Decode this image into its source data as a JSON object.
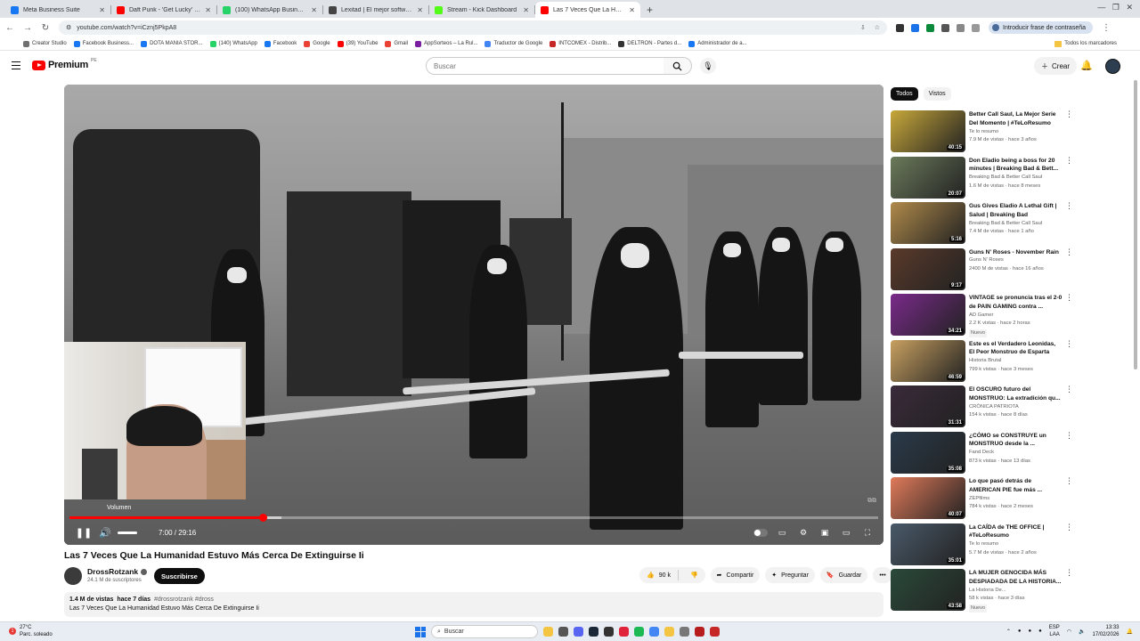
{
  "browser": {
    "tabs": [
      {
        "title": "Meta Business Suite",
        "color": "#1877f2",
        "active": false
      },
      {
        "title": "Daft Punk - 'Get Lucky' (10 min...",
        "color": "#ff0000",
        "active": false
      },
      {
        "title": "(100) WhatsApp Business",
        "color": "#25d366",
        "active": false
      },
      {
        "title": "Lexitad | El mejor software para...",
        "color": "#444444",
        "active": false
      },
      {
        "title": "Stream - Kick Dashboard",
        "color": "#53fc18",
        "active": false
      },
      {
        "title": "Las 7 Veces Que La Human...",
        "color": "#ff0000",
        "active": true
      }
    ],
    "url": "youtube.com/watch?v=iCznj5PkpA8",
    "profile_label": "Introducir frase de contraseña",
    "bookmarks": [
      {
        "label": "Creator Studio",
        "color": "#6f6f6f"
      },
      {
        "label": "Facebook Business...",
        "color": "#1877f2"
      },
      {
        "label": "DOTA MANIA STOR...",
        "color": "#1877f2"
      },
      {
        "label": "(140) WhatsApp",
        "color": "#25d366"
      },
      {
        "label": "Facebook",
        "color": "#1877f2"
      },
      {
        "label": "Google",
        "color": "#ea4335"
      },
      {
        "label": "(39) YouTube",
        "color": "#ff0000"
      },
      {
        "label": "Gmail",
        "color": "#ea4335"
      },
      {
        "label": "AppSorteos – La Rul...",
        "color": "#7b1fa2"
      },
      {
        "label": "Traductor de Google",
        "color": "#4285f4"
      },
      {
        "label": "INTCOMEX - Distrib...",
        "color": "#c62828"
      },
      {
        "label": "DELTRON - Partes d...",
        "color": "#333333"
      },
      {
        "label": "Administrador de a...",
        "color": "#1877f2"
      }
    ],
    "all_bookmarks": "Todos los marcadores"
  },
  "youtube": {
    "logo_text": "Premium",
    "logo_country": "PE",
    "search_placeholder": "Buscar",
    "create_label": "Crear",
    "player": {
      "tooltip": "Volumen",
      "current_time": "7:00",
      "duration": "29:16",
      "time_display": "7:00 / 29:16",
      "progress_fraction": 0.239,
      "buffered_fraction": 0.262
    },
    "video": {
      "title": "Las 7 Veces Que La Humanidad Estuvo Más Cerca De Extinguirse Ii",
      "channel": "DrossRotzank",
      "subscribers": "24.1 M de suscriptores",
      "subscribe_label": "Suscribirse",
      "likes": "90 k",
      "share_label": "Compartir",
      "ask_label": "Preguntar",
      "save_label": "Guardar",
      "views": "1.4 M de vistas",
      "age": "hace 7 días",
      "hashtags": "#drossrotzank #dross",
      "description": "Las 7 Veces Que La Humanidad Estuvo Más Cerca De Extinguirse Ii"
    },
    "chips": [
      "Todos",
      "Vistos"
    ],
    "recommendations": [
      {
        "title": "Better Call Saul, La Mejor Serie Del Momento | #TeLoResumo",
        "channel": "Te lo resumo",
        "views": "7.9 M de vistas · hace 3 años",
        "duration": "40:15",
        "bg": "#c8a83a",
        "new": ""
      },
      {
        "title": "Don Eladio being a boss for 20 minutes | Breaking Bad & Bett...",
        "channel": "Breaking Bad & Better Call Saul",
        "views": "1.6 M de vistas · hace 8 meses",
        "duration": "20:07",
        "bg": "#6b7a5a",
        "new": ""
      },
      {
        "title": "Gus Gives Eladio A Lethal Gift | Salud | Breaking Bad",
        "channel": "Breaking Bad & Better Call Saul",
        "views": "7.4 M de vistas · hace 1 año",
        "duration": "5:16",
        "bg": "#b08a4a",
        "new": ""
      },
      {
        "title": "Guns N' Roses - November Rain",
        "channel": "Guns N' Roses",
        "views": "2400 M de vistas · hace 16 años",
        "duration": "9:17",
        "bg": "#5a3a2a",
        "new": ""
      },
      {
        "title": "VINTAGE se pronuncia tras el 2-0 de PAIN GAMING contra ...",
        "channel": "AD Gamer",
        "views": "2.2 K vistas · hace 2 horas",
        "duration": "34:21",
        "bg": "#7a2a8a",
        "new": "Nuevo"
      },
      {
        "title": "Este es el Verdadero Leonidas, El Peor Monstruo de Esparta",
        "channel": "Historia Brutal",
        "views": "799 k vistas · hace 3 meses",
        "duration": "46:59",
        "bg": "#c8a060",
        "new": ""
      },
      {
        "title": "El OSCURO futuro del MONSTRUO: La extradición qu...",
        "channel": "CRÓNICA PATRIOTA",
        "views": "154 k vistas · hace 8 días",
        "duration": "31:31",
        "bg": "#3a2a3a",
        "new": ""
      },
      {
        "title": "¿CÓMO se CONSTRUYE un MONSTRUO desde la ...",
        "channel": "Fand Deck",
        "views": "873 k vistas · hace 13 días",
        "duration": "35:08",
        "bg": "#2a3a4a",
        "new": ""
      },
      {
        "title": "Lo que pasó detrás de AMERICAN PIE fue más ...",
        "channel": "ZEPfilms",
        "views": "784 k vistas · hace 2 meses",
        "duration": "40:07",
        "bg": "#e07a5a",
        "new": ""
      },
      {
        "title": "La CAÍDA de THE OFFICE | #TeLoResumo",
        "channel": "Te lo resumo",
        "views": "5.7 M de vistas · hace 2 años",
        "duration": "35:01",
        "bg": "#4a5a6a",
        "new": ""
      },
      {
        "title": "LA MUJER GENOCIDA MÁS DESPIADADA DE LA HISTORIA...",
        "channel": "La Historia De...",
        "views": "58 k vistas · hace 3 días",
        "duration": "43:58",
        "bg": "#2a4a3a",
        "new": "Nuevo"
      }
    ]
  },
  "taskbar": {
    "temperature": "27°C",
    "weather": "Parc. soleado",
    "search_label": "Buscar",
    "language": "ESP",
    "language2": "LAA",
    "time": "13:33",
    "date": "17/02/2026",
    "notifications": "1"
  }
}
